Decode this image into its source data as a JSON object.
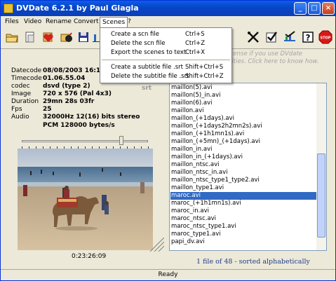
{
  "window": {
    "title": "DVDate 6.2.1 by Paul Glagla",
    "colors": {
      "titlebar": "#0a4fd8",
      "selection": "#316ac5",
      "face": "#ece9d8",
      "link_blue": "#1f3b8a",
      "gray_text": "#a5a5a5"
    }
  },
  "titlebar_buttons": {
    "minimize": "_",
    "maximize": "□",
    "close": "×"
  },
  "menubar": {
    "items": [
      "Files",
      "Video",
      "Rename",
      "Convert",
      "Scenes",
      "?"
    ]
  },
  "scenes_menu": {
    "items": [
      {
        "label": "Create a scn file",
        "shortcut": "Ctrl+S"
      },
      {
        "label": "Delete the scn file",
        "shortcut": "Ctrl+Z"
      },
      {
        "label": "Export the scenes to text",
        "shortcut": "Ctrl+X"
      },
      {
        "label": "Create a subtitle file .srt",
        "shortcut": "Shift+Ctrl+S"
      },
      {
        "label": "Delete the subtitle file .srt",
        "shortcut": "Shift+Ctrl+Z"
      }
    ]
  },
  "toolbar": {
    "left_icons": [
      "open-folder-icon",
      "open-file-icon",
      "heart-icon",
      "bomb-icon",
      "save-disk-icon",
      "bar-chart-icon"
    ],
    "right_icons": [
      "tools-icon",
      "checkmark-icon",
      "chart-check-icon",
      "help-icon",
      "stop-icon"
    ],
    "stop_label": "STOP"
  },
  "register_notice": {
    "line1": "license if you use DVdate",
    "line2": "ivities. Click here to know how."
  },
  "info": {
    "fields": [
      {
        "label": "Datecode",
        "value": "08/08/2003 16:19:52"
      },
      {
        "label": "Timecode",
        "value": "01.06.55.04"
      },
      {
        "label": "codec",
        "value": "dsvd (type 2)"
      },
      {
        "label": "Image",
        "value": "720 x 576 (Pal 4x3)"
      },
      {
        "label": "Duration",
        "value": "29mn 28s 03fr"
      },
      {
        "label": "Fps",
        "value": "25"
      },
      {
        "label": "Audio",
        "value": "32000Hz 12(16) bits  stereo"
      }
    ],
    "audio_line2": "PCM 128000 bytes/s",
    "srt_label": "srt"
  },
  "player": {
    "position": 0.79,
    "time": "0:23:26:09"
  },
  "file_list": {
    "items": [
      "maillon(5).avi",
      "maillon(5)_in.avi",
      "maillon(6).avi",
      "maillon.avi",
      "maillon_(+1days).avi",
      "maillon_(+1days2h2mn2s).avi",
      "maillon_(+1h1mn1s).avi",
      "maillon_(+5mn)_(+1days).avi",
      "maillon_in.avi",
      "maillon_in_(+1days).avi",
      "maillon_ntsc.avi",
      "maillon_ntsc_in.avi",
      "maillon_ntsc_type1_type2.avi",
      "maillon_type1.avi",
      "maroc.avi",
      "maroc_(+1h1mn1s).avi",
      "maroc_in.avi",
      "maroc_ntsc.avi",
      "maroc_ntsc_type1.avi",
      "maroc_type1.avi",
      "papi_dv.avi"
    ],
    "selected_index": 14,
    "summary": "1 file of 48 - sorted alphabetically"
  },
  "status": {
    "text": "Ready"
  }
}
